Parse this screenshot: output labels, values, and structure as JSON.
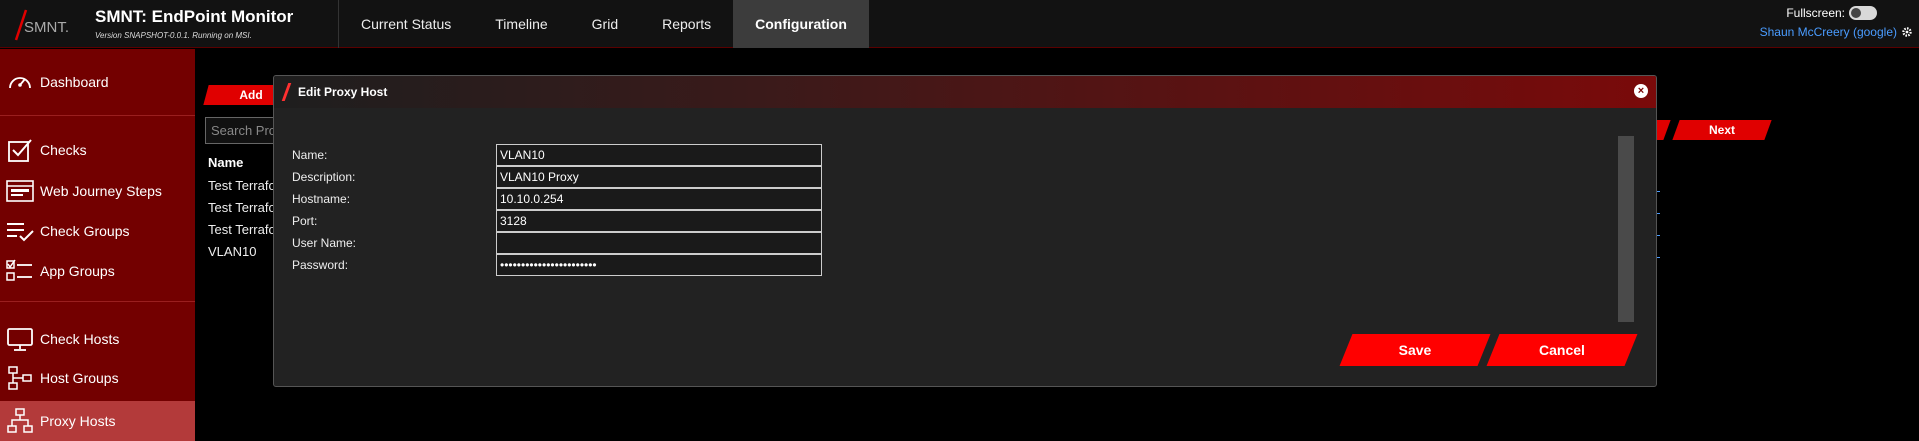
{
  "header": {
    "logo_text": "SMNT.",
    "title": "SMNT: EndPoint Monitor",
    "subtitle": "Version SNAPSHOT-0.0.1. Running on MSI.",
    "tabs": [
      {
        "label": "Current Status"
      },
      {
        "label": "Timeline"
      },
      {
        "label": "Grid"
      },
      {
        "label": "Reports"
      },
      {
        "label": "Configuration",
        "active": true
      }
    ],
    "fullscreen_label": "Fullscreen:",
    "fullscreen_on": false,
    "user_label": "Shaun McCreery (google)"
  },
  "sidebar": {
    "items": [
      {
        "label": "Dashboard",
        "icon": "gauge-icon"
      },
      {
        "label": "Checks",
        "icon": "checkbox-icon"
      },
      {
        "label": "Web Journey Steps",
        "icon": "browser-window-icon"
      },
      {
        "label": "Check Groups",
        "icon": "list-check-icon"
      },
      {
        "label": "App Groups",
        "icon": "checklist-icon"
      },
      {
        "label": "Check Hosts",
        "icon": "monitor-icon"
      },
      {
        "label": "Host Groups",
        "icon": "network-group-icon"
      },
      {
        "label": "Proxy Hosts",
        "icon": "network-tree-icon",
        "active": true
      }
    ]
  },
  "background": {
    "add_label": "Add",
    "search_placeholder": "Search Pro",
    "column_name": "Name",
    "rows": [
      "Test Terrafo",
      "Test Terrafo",
      "Test Terrafo",
      "VLAN10"
    ],
    "next_label": "Next"
  },
  "modal": {
    "title": "Edit Proxy Host",
    "fields": [
      {
        "label": "Name:",
        "value": "VLAN10"
      },
      {
        "label": "Description:",
        "value": "VLAN10 Proxy"
      },
      {
        "label": "Hostname:",
        "value": "10.10.0.254"
      },
      {
        "label": "Port:",
        "value": "3128"
      },
      {
        "label": "User Name:",
        "value": ""
      },
      {
        "label": "Password:",
        "value": "•••••••••••••••••••••••"
      }
    ],
    "save_label": "Save",
    "cancel_label": "Cancel"
  },
  "colors": {
    "accent": "#ff0000",
    "sidebar_bg": "#730000",
    "sidebar_active": "#b33a3a",
    "link": "#4a9cff"
  }
}
